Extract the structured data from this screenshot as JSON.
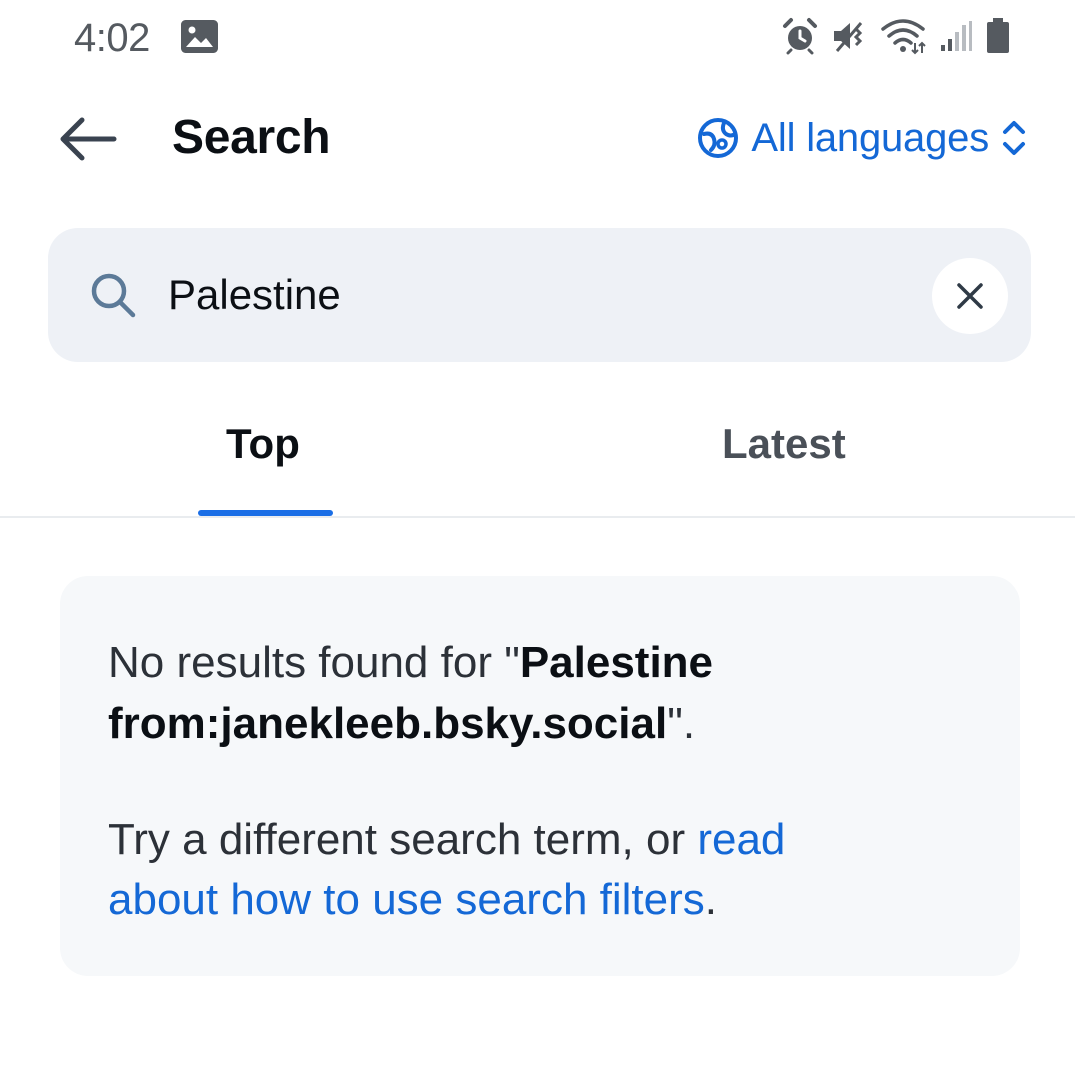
{
  "status_bar": {
    "time": "4:02",
    "icons": [
      "gallery-icon",
      "alarm-icon",
      "vibrate-icon",
      "wifi-icon",
      "signal-icon",
      "battery-icon"
    ]
  },
  "header": {
    "title": "Search",
    "language_selector": "All languages"
  },
  "search": {
    "value": "Palestine"
  },
  "tabs": [
    {
      "label": "Top",
      "active": true
    },
    {
      "label": "Latest",
      "active": false
    }
  ],
  "empty_state": {
    "message_prefix": "No results found for \"",
    "query_line1": "Palestine",
    "query_line2": "from:janekleeb.bsky.social",
    "message_suffix": "\".",
    "hint_prefix": "Try a different search term, or ",
    "link_line1": "read",
    "link_line2": "about how to use search filters",
    "hint_suffix": "."
  },
  "colors": {
    "accent": "#1468d6",
    "tab_indicator": "#1a6ee6",
    "search_bg": "#eef1f6",
    "card_bg": "#f6f8fa"
  }
}
